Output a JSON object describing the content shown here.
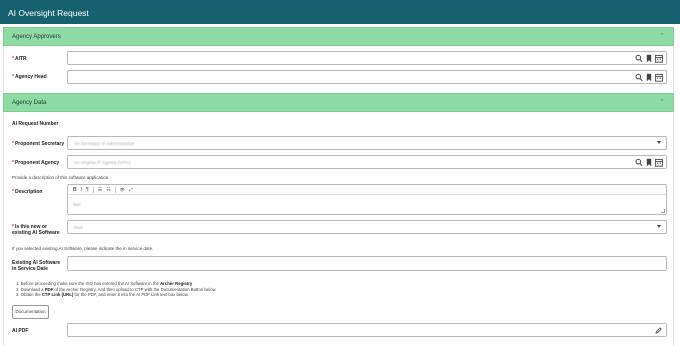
{
  "window": {
    "title": "AI Oversight Request"
  },
  "agency_approvers": {
    "header": "Agency Approvers",
    "fields": [
      {
        "label": "AITR",
        "required": true,
        "value": ""
      },
      {
        "label": "Agency Head",
        "required": true,
        "value": ""
      }
    ]
  },
  "agency_data": {
    "header": "Agency Data",
    "request_number_label": "AI Request Number",
    "proponent_secretary": {
      "label": "Proponent Secretary",
      "required": true,
      "value": "VA Secretary of Administration"
    },
    "proponent_agency": {
      "label": "Proponent Agency",
      "required": true,
      "value": "VA Virginia IT Agency (VITA)"
    },
    "description_help": "Provide a description of this software application.",
    "description": {
      "label": "Description",
      "required": true,
      "value": "test",
      "toolbar": [
        "B",
        "I",
        "¶",
        "☰",
        "☷",
        "👁",
        "⤢"
      ]
    },
    "new_or_existing": {
      "label": "Is this new or existing AI Software",
      "required": true,
      "value": "New"
    },
    "in_service_help": "If you selected existing AI Software, please indicate the in service date.",
    "existing_in_service": {
      "label": "Existing AI Software in Service Date",
      "value": ""
    },
    "steps": [
      {
        "n": "1.",
        "pre": "Before proceeding make sure the ISO has entered the AI Software in the ",
        "bold": "Archer Registry",
        "post": ""
      },
      {
        "n": "2.",
        "pre": "Download a ",
        "bold": "PDF",
        "post": " of the Archer Registry. And then upload to CTP with the Documentation Button below."
      },
      {
        "n": "3.",
        "pre": "Obtain the ",
        "bold": "CTP Link (URL)",
        "post": " for the PDF, and enter it into the AI PDF Link text box below."
      }
    ],
    "documentation_button": "Documentation",
    "ai_pdf": {
      "label": "AI PDF",
      "value": ""
    }
  },
  "colors": {
    "titlebar": "#16606f",
    "section_header": "#8fdba6",
    "required": "#dd2233"
  }
}
